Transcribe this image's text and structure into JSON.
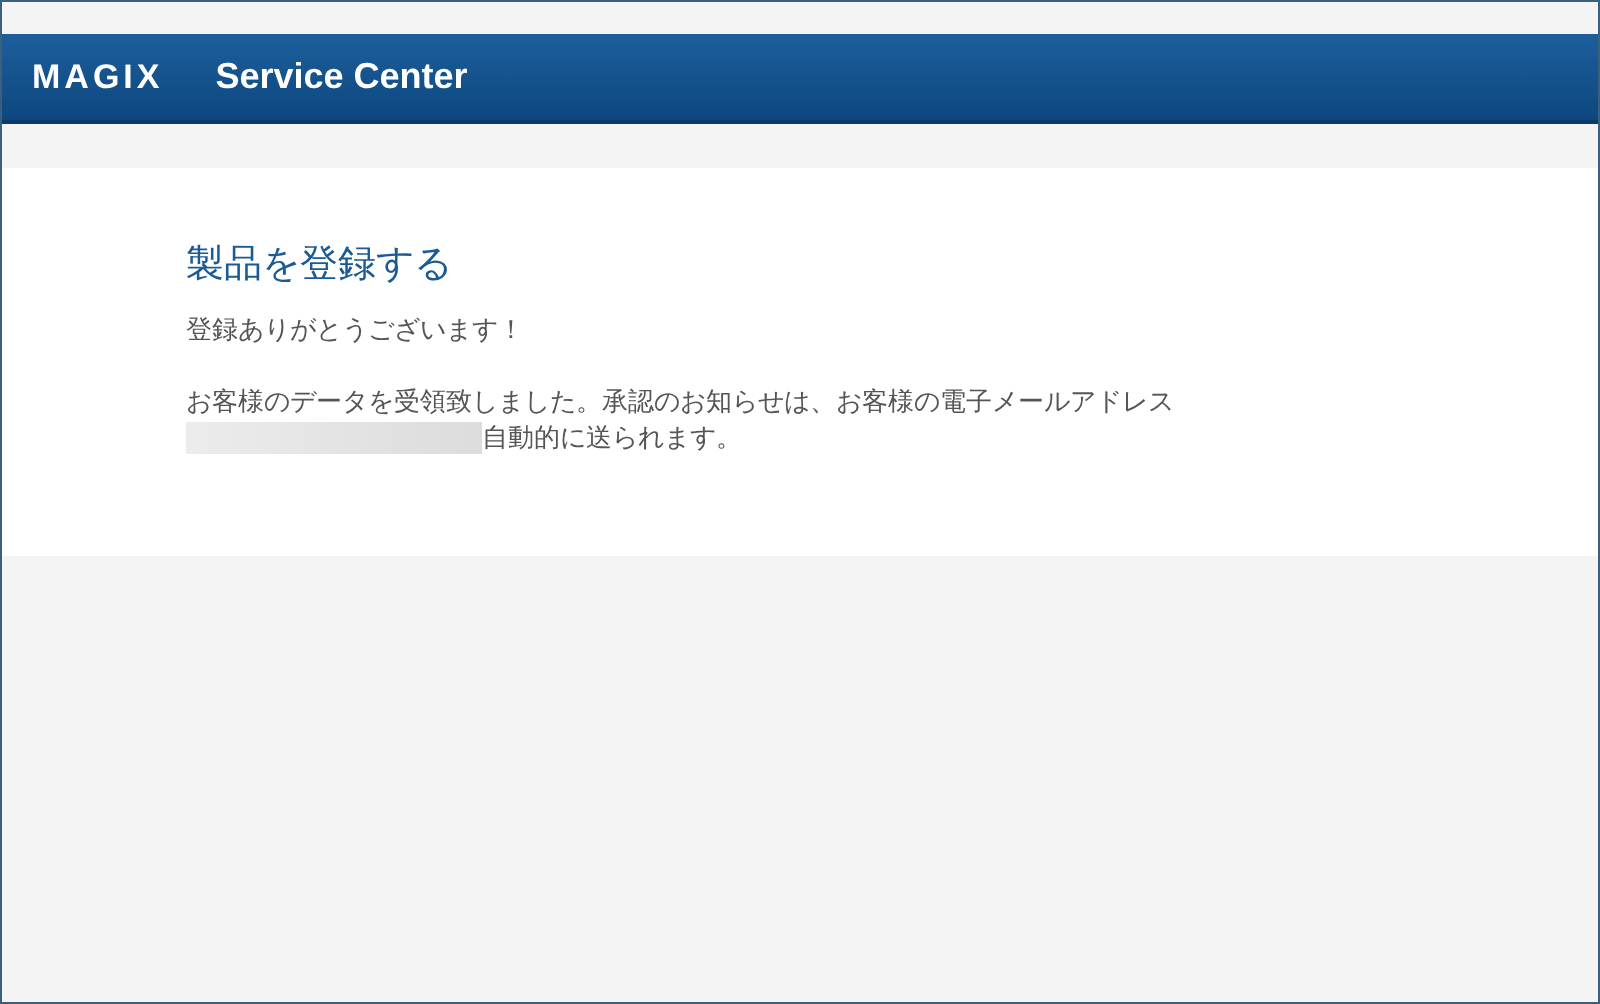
{
  "header": {
    "logo": "MAGIX",
    "title": "Service Center"
  },
  "content": {
    "heading": "製品を登録する",
    "thanks": "登録ありがとうございます！",
    "message": "お客様のデータを受領致しました。承認のお知らせは、お客様の電子メールアドレス",
    "message_end": "自動的に送られます。"
  }
}
